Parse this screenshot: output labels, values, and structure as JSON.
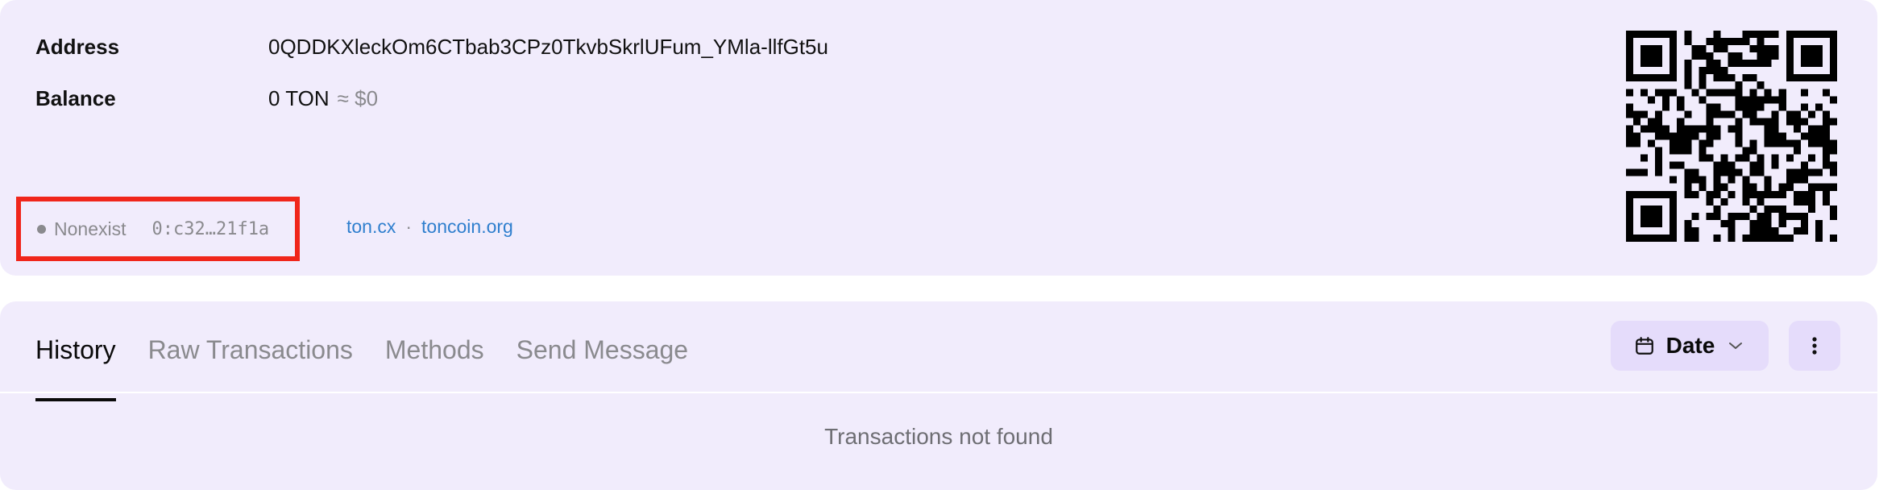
{
  "account": {
    "address_label": "Address",
    "address": "0QDDKXleckOm6CTbab3CPz0TkvbSkrlUFum_YMla-llfGt5u",
    "balance_label": "Balance",
    "balance_ton": "0 TON",
    "balance_usd": "≈ $0",
    "status": "Nonexist",
    "raw_address": "0:c32…21f1a"
  },
  "links": [
    {
      "label": "ton.cx"
    },
    {
      "label": "toncoin.org"
    }
  ],
  "link_separator": "·",
  "tabs": [
    {
      "label": "History",
      "active": true
    },
    {
      "label": "Raw Transactions",
      "active": false
    },
    {
      "label": "Methods",
      "active": false
    },
    {
      "label": "Send Message",
      "active": false
    }
  ],
  "filters": {
    "date_label": "Date"
  },
  "empty_state": "Transactions not found",
  "icons": {
    "calendar": "calendar-icon",
    "chevron": "chevron-down-icon",
    "more": "more-vertical-icon",
    "qr": "qr-code-icon"
  },
  "colors": {
    "card_bg": "#f1ecfc",
    "button_bg": "#e5dcfb",
    "link": "#2f7fce",
    "muted": "#8a8a8e",
    "highlight": "#f0261b"
  }
}
